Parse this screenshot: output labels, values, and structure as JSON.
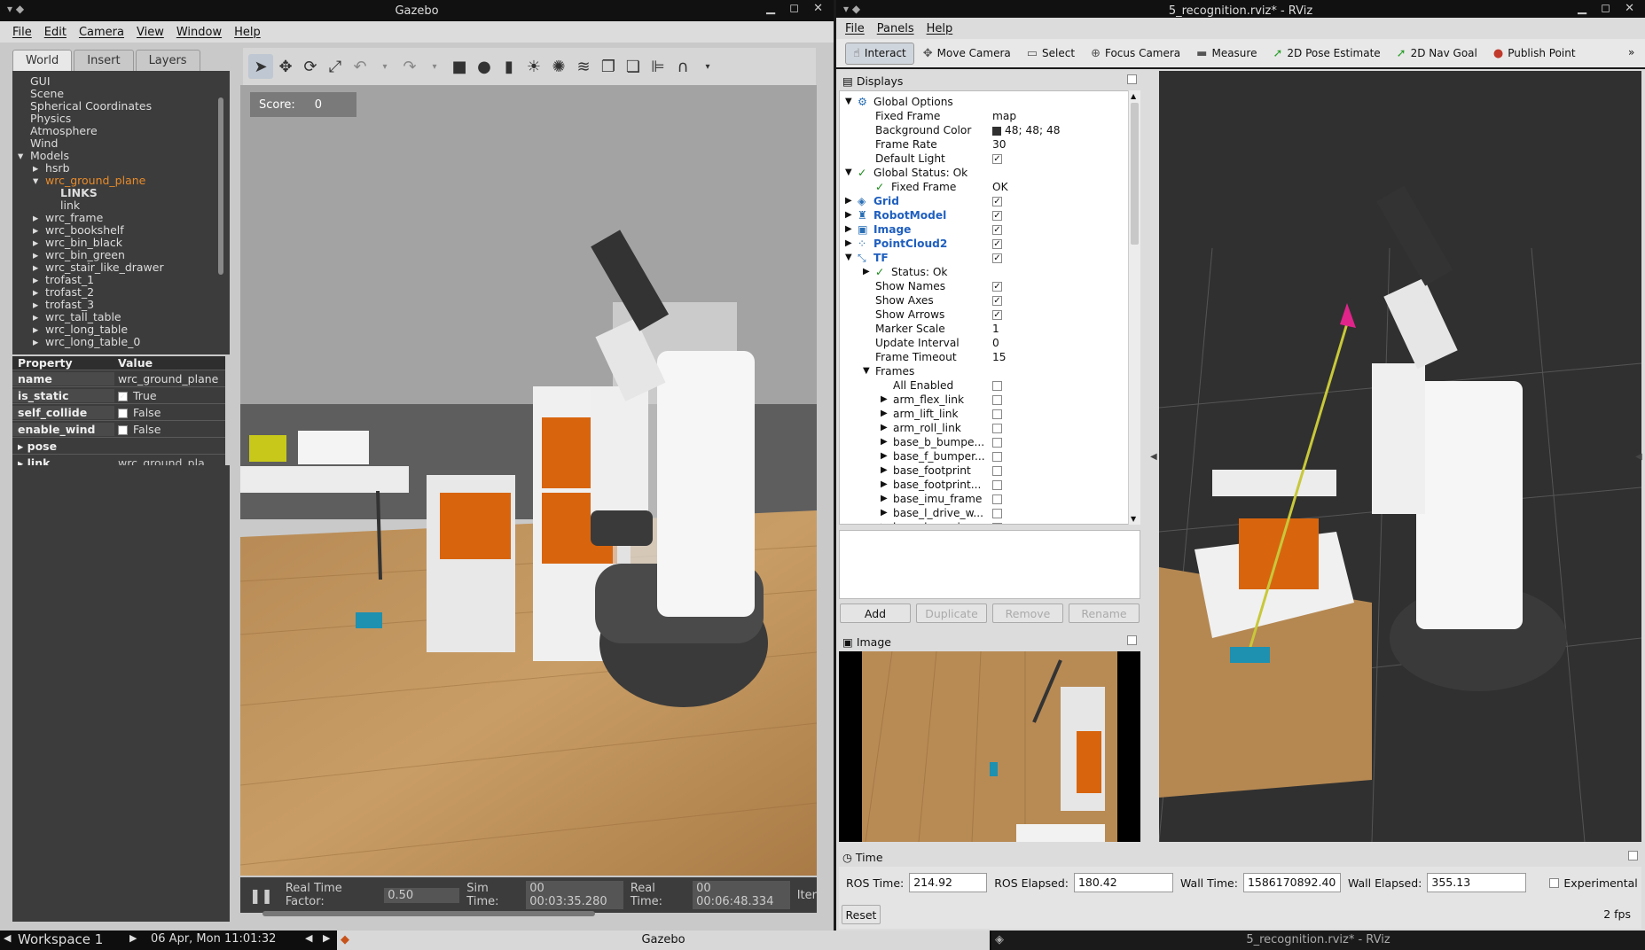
{
  "gazebo": {
    "title": "Gazebo",
    "menu": [
      "File",
      "Edit",
      "Camera",
      "View",
      "Window",
      "Help"
    ],
    "tabs": [
      "World",
      "Insert",
      "Layers"
    ],
    "tree": [
      {
        "label": "GUI",
        "indent": 0,
        "arrow": ""
      },
      {
        "label": "Scene",
        "indent": 0,
        "arrow": ""
      },
      {
        "label": "Spherical Coordinates",
        "indent": 0,
        "arrow": ""
      },
      {
        "label": "Physics",
        "indent": 0,
        "arrow": ""
      },
      {
        "label": "Atmosphere",
        "indent": 0,
        "arrow": ""
      },
      {
        "label": "Wind",
        "indent": 0,
        "arrow": ""
      },
      {
        "label": "Models",
        "indent": 0,
        "arrow": "open"
      },
      {
        "label": "hsrb",
        "indent": 1,
        "arrow": "closed"
      },
      {
        "label": "wrc_ground_plane",
        "indent": 1,
        "arrow": "open",
        "selected": true
      },
      {
        "label": "LINKS",
        "indent": 2,
        "arrow": "",
        "bold": true
      },
      {
        "label": "link",
        "indent": 2,
        "arrow": ""
      },
      {
        "label": "wrc_frame",
        "indent": 1,
        "arrow": "closed"
      },
      {
        "label": "wrc_bookshelf",
        "indent": 1,
        "arrow": "closed"
      },
      {
        "label": "wrc_bin_black",
        "indent": 1,
        "arrow": "closed"
      },
      {
        "label": "wrc_bin_green",
        "indent": 1,
        "arrow": "closed"
      },
      {
        "label": "wrc_stair_like_drawer",
        "indent": 1,
        "arrow": "closed"
      },
      {
        "label": "trofast_1",
        "indent": 1,
        "arrow": "closed"
      },
      {
        "label": "trofast_2",
        "indent": 1,
        "arrow": "closed"
      },
      {
        "label": "trofast_3",
        "indent": 1,
        "arrow": "closed"
      },
      {
        "label": "wrc_tall_table",
        "indent": 1,
        "arrow": "closed"
      },
      {
        "label": "wrc_long_table",
        "indent": 1,
        "arrow": "closed"
      },
      {
        "label": "wrc_long_table_0",
        "indent": 1,
        "arrow": "closed"
      }
    ],
    "prop_header": {
      "property": "Property",
      "value": "Value"
    },
    "props": [
      {
        "key": "name",
        "value": "wrc_ground_plane",
        "check": null
      },
      {
        "key": "is_static",
        "value": "True",
        "check": true
      },
      {
        "key": "self_collide",
        "value": "False",
        "check": false
      },
      {
        "key": "enable_wind",
        "value": "False",
        "check": false
      },
      {
        "key": "pose",
        "value": "",
        "arrow": true
      },
      {
        "key": "link",
        "value": "wrc_ground_pla...",
        "arrow": true
      }
    ],
    "score_label": "Score:",
    "score_value": "0",
    "status": {
      "rtf_label": "Real Time Factor:",
      "rtf": "0.50",
      "sim_label": "Sim Time:",
      "sim": "00 00:03:35.280",
      "real_label": "Real Time:",
      "real": "00 00:06:48.334",
      "iter_label": "Iter"
    }
  },
  "rviz": {
    "title": "5_recognition.rviz* - RViz",
    "menu": [
      "File",
      "Panels",
      "Help"
    ],
    "tools": [
      {
        "label": "Interact",
        "icon": "interact-icon",
        "glyph": "☝",
        "active": true
      },
      {
        "label": "Move Camera",
        "icon": "move-camera-icon",
        "glyph": "✥"
      },
      {
        "label": "Select",
        "icon": "select-icon",
        "glyph": "▭"
      },
      {
        "label": "Focus Camera",
        "icon": "focus-camera-icon",
        "glyph": "⊕"
      },
      {
        "label": "Measure",
        "icon": "measure-icon",
        "glyph": "▬"
      },
      {
        "label": "2D Pose Estimate",
        "icon": "pose-estimate-icon",
        "glyph": "➚"
      },
      {
        "label": "2D Nav Goal",
        "icon": "nav-goal-icon",
        "glyph": "➚"
      },
      {
        "label": "Publish Point",
        "icon": "publish-point-icon",
        "glyph": "●"
      }
    ],
    "displays_title": "Displays",
    "displays": [
      {
        "label": "Global Options",
        "indent": 0,
        "arrow": "open",
        "icon": "⚙",
        "val": ""
      },
      {
        "label": "Fixed Frame",
        "indent": 1,
        "val": "map"
      },
      {
        "label": "Background Color",
        "indent": 1,
        "val": "48; 48; 48",
        "swatch": true
      },
      {
        "label": "Frame Rate",
        "indent": 1,
        "val": "30"
      },
      {
        "label": "Default Light",
        "indent": 1,
        "check": true
      },
      {
        "label": "Global Status: Ok",
        "indent": 0,
        "arrow": "open",
        "icon": "✓",
        "val": ""
      },
      {
        "label": "Fixed Frame",
        "indent": 1,
        "icon": "✓",
        "val": "OK"
      },
      {
        "label": "Grid",
        "indent": 0,
        "arrow": "closed",
        "icon": "◈",
        "blue": true,
        "check": true
      },
      {
        "label": "RobotModel",
        "indent": 0,
        "arrow": "closed",
        "icon": "♜",
        "blue": true,
        "check": true
      },
      {
        "label": "Image",
        "indent": 0,
        "arrow": "closed",
        "icon": "▣",
        "blue": true,
        "check": true
      },
      {
        "label": "PointCloud2",
        "indent": 0,
        "arrow": "closed",
        "icon": "⁘",
        "blue": true,
        "check": true
      },
      {
        "label": "TF",
        "indent": 0,
        "arrow": "open",
        "icon": "⤡",
        "blue": true,
        "check": true
      },
      {
        "label": "Status: Ok",
        "indent": 1,
        "arrow": "closed",
        "icon": "✓",
        "val": ""
      },
      {
        "label": "Show Names",
        "indent": 1,
        "check": true
      },
      {
        "label": "Show Axes",
        "indent": 1,
        "check": true
      },
      {
        "label": "Show Arrows",
        "indent": 1,
        "check": true
      },
      {
        "label": "Marker Scale",
        "indent": 1,
        "val": "1"
      },
      {
        "label": "Update Interval",
        "indent": 1,
        "val": "0"
      },
      {
        "label": "Frame Timeout",
        "indent": 1,
        "val": "15"
      },
      {
        "label": "Frames",
        "indent": 1,
        "arrow": "open",
        "val": ""
      },
      {
        "label": "All Enabled",
        "indent": 2,
        "check": false
      },
      {
        "label": "arm_flex_link",
        "indent": 2,
        "arrow": "closed",
        "check": false
      },
      {
        "label": "arm_lift_link",
        "indent": 2,
        "arrow": "closed",
        "check": false
      },
      {
        "label": "arm_roll_link",
        "indent": 2,
        "arrow": "closed",
        "check": false
      },
      {
        "label": "base_b_bumpe...",
        "indent": 2,
        "arrow": "closed",
        "check": false
      },
      {
        "label": "base_f_bumper...",
        "indent": 2,
        "arrow": "closed",
        "check": false
      },
      {
        "label": "base_footprint",
        "indent": 2,
        "arrow": "closed",
        "check": false
      },
      {
        "label": "base_footprint...",
        "indent": 2,
        "arrow": "closed",
        "check": false
      },
      {
        "label": "base_imu_frame",
        "indent": 2,
        "arrow": "closed",
        "check": false
      },
      {
        "label": "base_l_drive_w...",
        "indent": 2,
        "arrow": "closed",
        "check": false
      },
      {
        "label": "base_l_passive...",
        "indent": 2,
        "arrow": "closed",
        "check": false
      }
    ],
    "buttons": {
      "add": "Add",
      "duplicate": "Duplicate",
      "remove": "Remove",
      "rename": "Rename"
    },
    "image_title": "Image",
    "time_title": "Time",
    "time": {
      "ros_time_label": "ROS Time:",
      "ros_time": "214.92",
      "ros_elapsed_label": "ROS Elapsed:",
      "ros_elapsed": "180.42",
      "wall_time_label": "Wall Time:",
      "wall_time": "1586170892.40",
      "wall_elapsed_label": "Wall Elapsed:",
      "wall_elapsed": "355.13",
      "experimental": "Experimental",
      "reset": "Reset",
      "fps": "2 fps"
    }
  },
  "taskbar": {
    "workspace": "Workspace 1",
    "datetime": "06 Apr, Mon 11:01:32",
    "gazebo": "Gazebo",
    "rviz": "5_recognition.rviz* - RViz"
  }
}
